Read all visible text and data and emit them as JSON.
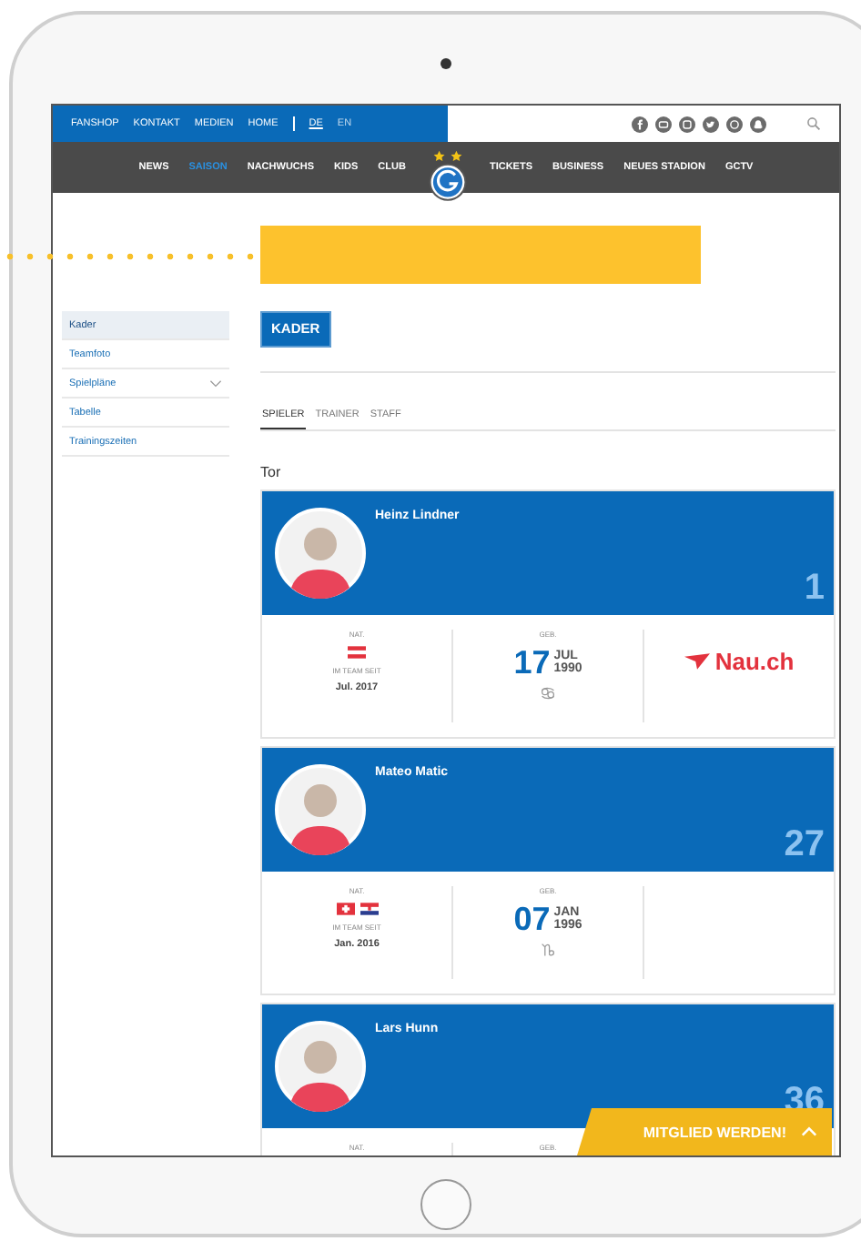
{
  "topbar": {
    "links": [
      "FANSHOP",
      "KONTAKT",
      "MEDIEN",
      "HOME"
    ],
    "languages": [
      {
        "label": "DE",
        "selected": true
      },
      {
        "label": "EN",
        "selected": false
      }
    ],
    "social": [
      {
        "kind": "facebook"
      },
      {
        "kind": "youtube"
      },
      {
        "kind": "instagram"
      },
      {
        "kind": "twitter"
      },
      {
        "kind": "whatsapp"
      },
      {
        "kind": "snapchat"
      }
    ]
  },
  "nav": {
    "left": [
      {
        "label": "NEWS",
        "selected": false
      },
      {
        "label": "SAISON",
        "selected": true
      },
      {
        "label": "NACHWUCHS",
        "selected": false
      },
      {
        "label": "KIDS",
        "selected": false
      },
      {
        "label": "CLUB",
        "selected": false
      }
    ],
    "right": [
      {
        "label": "TICKETS",
        "selected": false
      },
      {
        "label": "BUSINESS",
        "selected": false
      },
      {
        "label": "NEUES STADION",
        "selected": false
      },
      {
        "label": "GCTV",
        "selected": false
      }
    ]
  },
  "sidebar": {
    "items": [
      {
        "label": "Kader",
        "selected": true,
        "expandable": false
      },
      {
        "label": "Teamfoto",
        "selected": false,
        "expandable": false
      },
      {
        "label": "Spielpläne",
        "selected": false,
        "expandable": true
      },
      {
        "label": "Tabelle",
        "selected": false,
        "expandable": false
      },
      {
        "label": "Trainingszeiten",
        "selected": false,
        "expandable": false
      }
    ]
  },
  "page_title": "KADER",
  "tabs": [
    {
      "label": "SPIELER",
      "selected": true
    },
    {
      "label": "TRAINER",
      "selected": false
    },
    {
      "label": "STAFF",
      "selected": false
    }
  ],
  "section": "Tor",
  "players": [
    {
      "name": "Heinz Lindner",
      "number": "1",
      "nat_label": "NAT.",
      "flags": [
        {
          "kind": "at"
        }
      ],
      "since_label": "IM TEAM SEIT",
      "since": "Jul. 2017",
      "birth_label": "GEB.",
      "day": "17",
      "month": "JUL",
      "year": "1990",
      "zodiac": {
        "kind": "cancer"
      },
      "sponsor": "Nau.ch"
    },
    {
      "name": "Mateo Matic",
      "number": "27",
      "nat_label": "NAT.",
      "flags": [
        {
          "kind": "ch"
        },
        {
          "kind": "hr"
        }
      ],
      "since_label": "IM TEAM SEIT",
      "since": "Jan. 2016",
      "birth_label": "GEB.",
      "day": "07",
      "month": "JAN",
      "year": "1996",
      "zodiac": {
        "kind": "capricorn"
      }
    },
    {
      "name": "Lars Hunn",
      "number": "36",
      "nat_label": "NAT.",
      "birth_label": "GEB."
    }
  ],
  "cta": "MITGLIED WERDEN!"
}
